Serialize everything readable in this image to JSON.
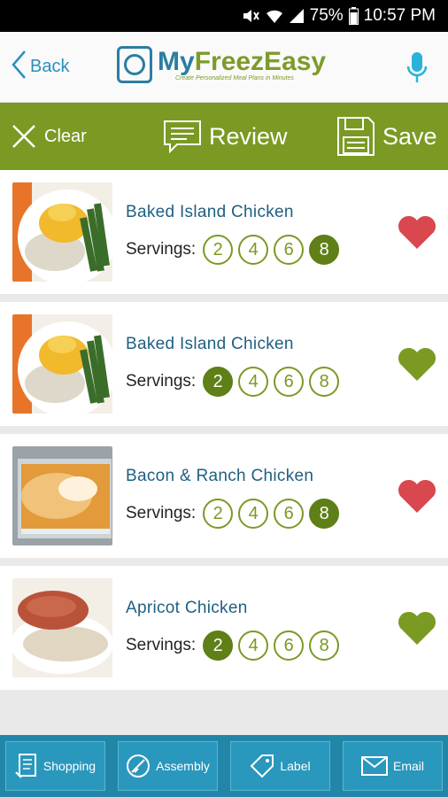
{
  "status": {
    "battery": "75%",
    "time": "10:57 PM"
  },
  "header": {
    "back_label": "Back",
    "logo_my": "My",
    "logo_freezeasy": "FreezEasy",
    "logo_tagline": "Create Personalized Meal Plans in Minutes"
  },
  "actions": {
    "clear": "Clear",
    "review": "Review",
    "save": "Save"
  },
  "servings_label": "Servings:",
  "colors": {
    "green": "#7a9a23",
    "blue": "#2286a9",
    "heart_red": "#d9474f",
    "heart_green": "#7a9a23"
  },
  "recipes": [
    {
      "title": "Baked Island Chicken",
      "options": [
        "2",
        "4",
        "6",
        "8"
      ],
      "selected": "8",
      "favorite": true,
      "image": "pineapple-chicken"
    },
    {
      "title": "Baked Island Chicken",
      "options": [
        "2",
        "4",
        "6",
        "8"
      ],
      "selected": "2",
      "favorite": false,
      "image": "pineapple-chicken"
    },
    {
      "title": "Bacon & Ranch Chicken",
      "options": [
        "2",
        "4",
        "6",
        "8"
      ],
      "selected": "8",
      "favorite": true,
      "image": "casserole"
    },
    {
      "title": "Apricot Chicken",
      "options": [
        "2",
        "4",
        "6",
        "8"
      ],
      "selected": "2",
      "favorite": false,
      "image": "glazed-chicken"
    }
  ],
  "bottom": {
    "shopping": "Shopping",
    "assembly": "Assembly",
    "label": "Label",
    "email": "Email"
  }
}
